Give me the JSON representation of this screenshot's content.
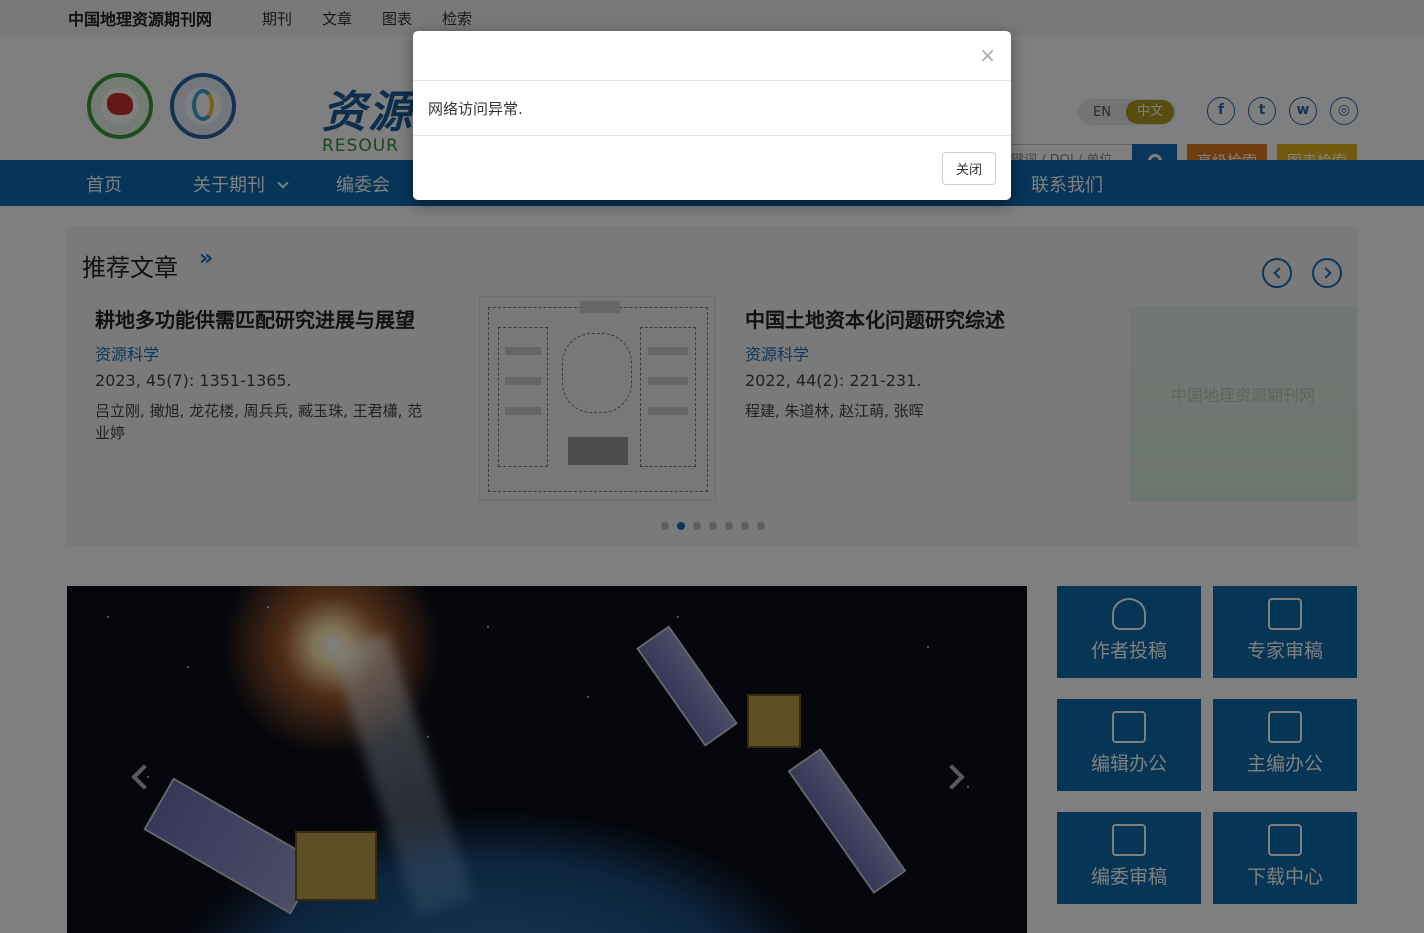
{
  "topbar": {
    "site_name": "中国地理资源期刊网",
    "links": [
      "期刊",
      "文章",
      "图表",
      "检索"
    ]
  },
  "header": {
    "brand_cn": "资源",
    "brand_en": "RESOUR",
    "lang": {
      "en": "EN",
      "zh": "中文"
    },
    "social_icons": [
      "facebook-icon",
      "twitter-icon",
      "weibo-icon",
      "wechat-icon"
    ],
    "search_placeholder": "键词 / DOI / 单位",
    "advanced_search": "高级检索",
    "chart_search": "图表检索"
  },
  "nav": {
    "items": [
      "首页",
      "关于期刊",
      "编委会",
      "联系我们"
    ]
  },
  "recommended": {
    "title": "推荐文章",
    "more": "»",
    "articles": [
      {
        "title": "耕地多功能供需匹配研究进展与展望",
        "journal": "资源科学",
        "cite": "2023, 45(7): 1351-1365.",
        "authors": "吕立刚, 撖旭, 龙花楼, 周兵兵, 臧玉珠, 王君櫹, 范业婷"
      },
      {
        "title": "中国土地资本化问题研究综述",
        "journal": "资源科学",
        "cite": "2022, 44(2): 221-231.",
        "authors": "程建, 朱道林, 赵江萌, 张晖"
      }
    ],
    "faded_card_text": "中国地理资源期刊网",
    "dots": 7,
    "active_dot": 1
  },
  "tiles": [
    {
      "label": "作者投稿",
      "icon": "author-icon"
    },
    {
      "label": "专家审稿",
      "icon": "expert-review-icon"
    },
    {
      "label": "编辑办公",
      "icon": "edit-office-icon"
    },
    {
      "label": "主编办公",
      "icon": "chief-editor-icon"
    },
    {
      "label": "编委审稿",
      "icon": "editorial-review-icon"
    },
    {
      "label": "下载中心",
      "icon": "download-icon"
    }
  ],
  "modal": {
    "close_x": "×",
    "message": "网络访问异常.",
    "close_button": "关闭"
  },
  "colors": {
    "nav": "#0a6bb0",
    "accent_orange": "#e07b1e",
    "accent_yellow": "#e6b21a",
    "lang_active": "#b29a25"
  }
}
